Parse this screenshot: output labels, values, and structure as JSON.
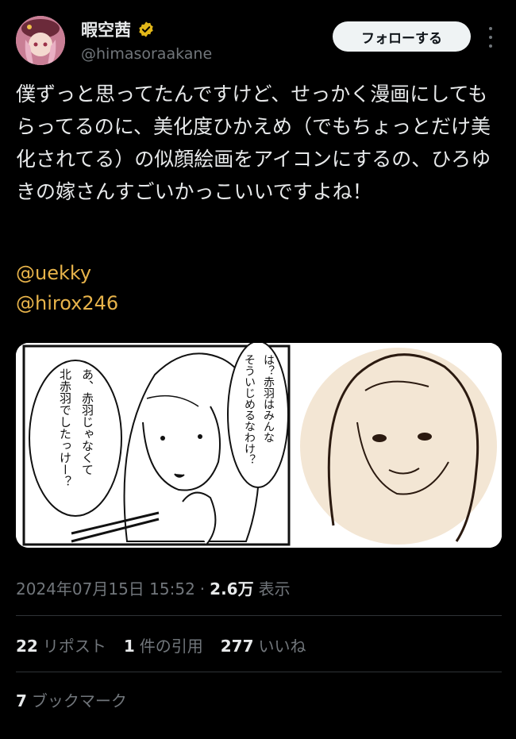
{
  "user": {
    "display_name": "暇空茜",
    "handle": "@himasoraakane",
    "follow_label": "フォローする"
  },
  "tweet": {
    "text": "僕ずっと思ってたんですけど、せっかく漫画にしてもらってるのに、美化度ひかえめ（でもちょっとだけ美化されてる）の似顔絵画をアイコンにするの、ひろゆきの嫁さんすごいかっこいいですよね！",
    "mentions": [
      "@uekky",
      "@hirox246"
    ]
  },
  "media": {
    "speech_left": [
      "あ、赤羽じゃなくて",
      "北赤羽でしたっけー？"
    ],
    "speech_right": [
      "は？赤羽はみんな",
      "そういじめるなわけ？"
    ]
  },
  "meta": {
    "timestamp": "2024年07月15日 15:52",
    "separator": "·",
    "views_count": "2.6万",
    "views_label": "表示"
  },
  "stats": {
    "reposts_count": "22",
    "reposts_label": "リポスト",
    "quotes_count": "1",
    "quotes_label": "件の引用",
    "likes_count": "277",
    "likes_label": "いいね",
    "bookmarks_count": "7",
    "bookmarks_label": "ブックマーク"
  },
  "colors": {
    "background": "#000000",
    "mention": "#e7b34a",
    "secondary_text": "#71767b",
    "verified_badge": "#e2b719"
  }
}
